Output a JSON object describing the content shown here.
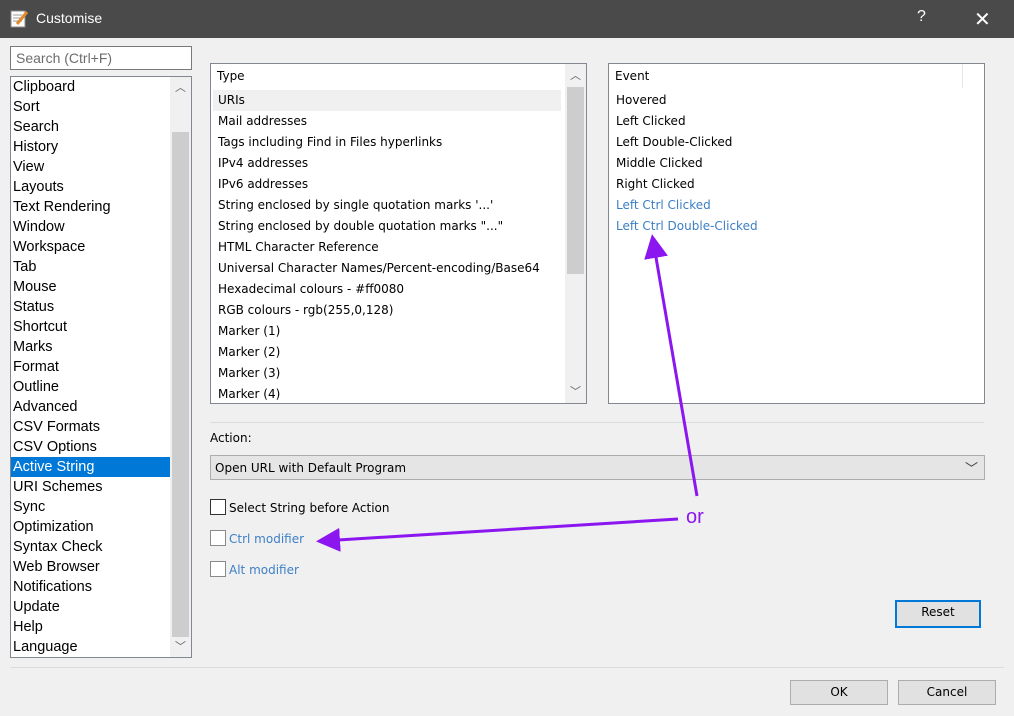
{
  "window": {
    "title": "Customise",
    "help": "?",
    "close": "✕"
  },
  "search": {
    "placeholder": "Search (Ctrl+F)"
  },
  "categories": [
    "Clipboard",
    "Sort",
    "Search",
    "History",
    "View",
    "Layouts",
    "Text Rendering",
    "Window",
    "Workspace",
    "Tab",
    "Mouse",
    "Status",
    "Shortcut",
    "Marks",
    "Format",
    "Outline",
    "Advanced",
    "CSV Formats",
    "CSV Options",
    "Active String",
    "URI Schemes",
    "Sync",
    "Optimization",
    "Syntax Check",
    "Web Browser",
    "Notifications",
    "Update",
    "Help",
    "Language"
  ],
  "selected_category": "Active String",
  "type_list": {
    "header": "Type",
    "items": [
      "URIs",
      "Mail addresses",
      "Tags including Find in Files hyperlinks",
      "IPv4 addresses",
      "IPv6 addresses",
      "String enclosed by single quotation marks '...'",
      "String enclosed by double quotation marks \"...\"",
      "HTML Character Reference",
      "Universal Character Names/Percent-encoding/Base64",
      "Hexadecimal colours - #ff0080",
      "RGB colours - rgb(255,0,128)",
      "Marker (1)",
      "Marker (2)",
      "Marker (3)",
      "Marker (4)"
    ]
  },
  "event_list": {
    "header": "Event",
    "items": [
      "Hovered",
      "Left Clicked",
      "Left Double-Clicked",
      "Middle Clicked",
      "Right Clicked",
      "Left Ctrl Clicked",
      "Left Ctrl Double-Clicked"
    ]
  },
  "action": {
    "label": "Action:",
    "value": "Open URL with Default Program"
  },
  "options": {
    "select_string": "Select String before Action",
    "ctrl_modifier": "Ctrl modifier",
    "alt_modifier": "Alt modifier"
  },
  "buttons": {
    "reset": "Reset",
    "ok": "OK",
    "cancel": "Cancel"
  },
  "annotation": {
    "text": "or",
    "color": "#8b16ef"
  }
}
